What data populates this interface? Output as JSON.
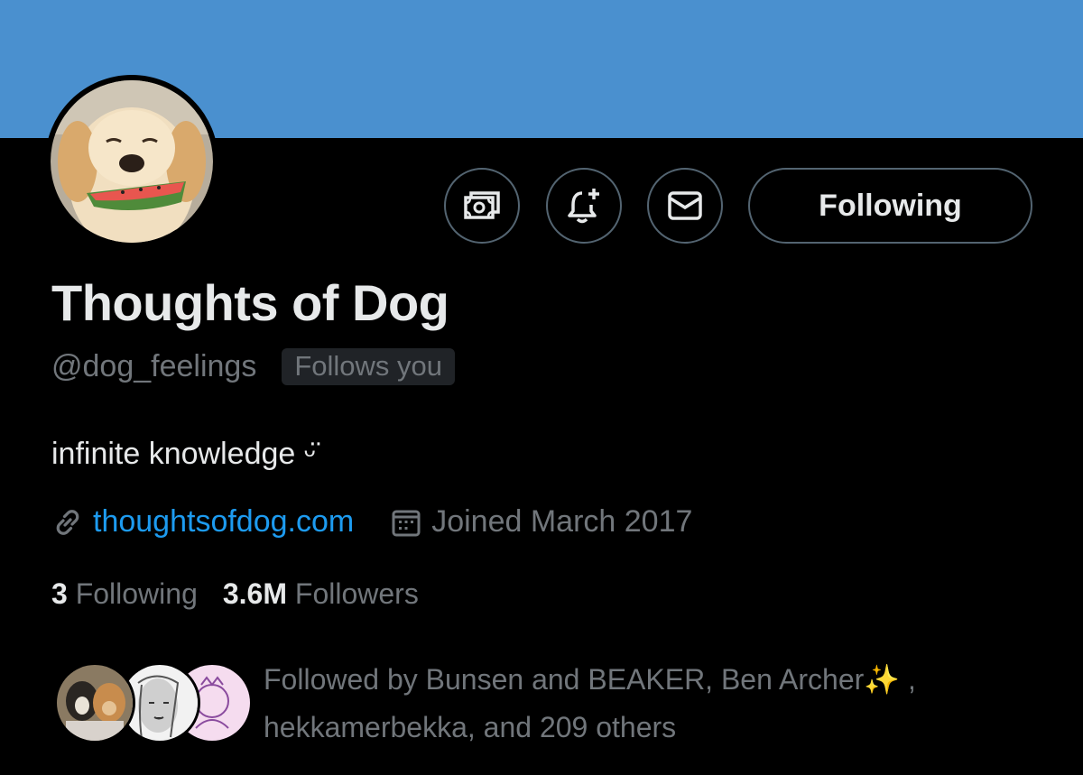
{
  "profile": {
    "display_name": "Thoughts of Dog",
    "handle": "@dog_feelings",
    "follows_you_badge": "Follows you",
    "bio": "infinite knowledge ᵕ̈",
    "website": "thoughtsofdog.com",
    "joined": "Joined March 2017"
  },
  "actions": {
    "tip_icon": "money-icon",
    "notify_icon": "bell-plus-icon",
    "message_icon": "envelope-icon",
    "following_label": "Following"
  },
  "stats": {
    "following_count": "3",
    "following_label": "Following",
    "followers_count": "3.6M",
    "followers_label": "Followers"
  },
  "followed_by": {
    "text": "Followed by Bunsen and BEAKER, Ben Archer✨ , hekkamerbekka, and 209 others"
  },
  "colors": {
    "banner": "#4a90cf",
    "background": "#000000",
    "link": "#1d9bf0",
    "secondary_text": "#71767b",
    "primary_text": "#e7e9ea"
  }
}
